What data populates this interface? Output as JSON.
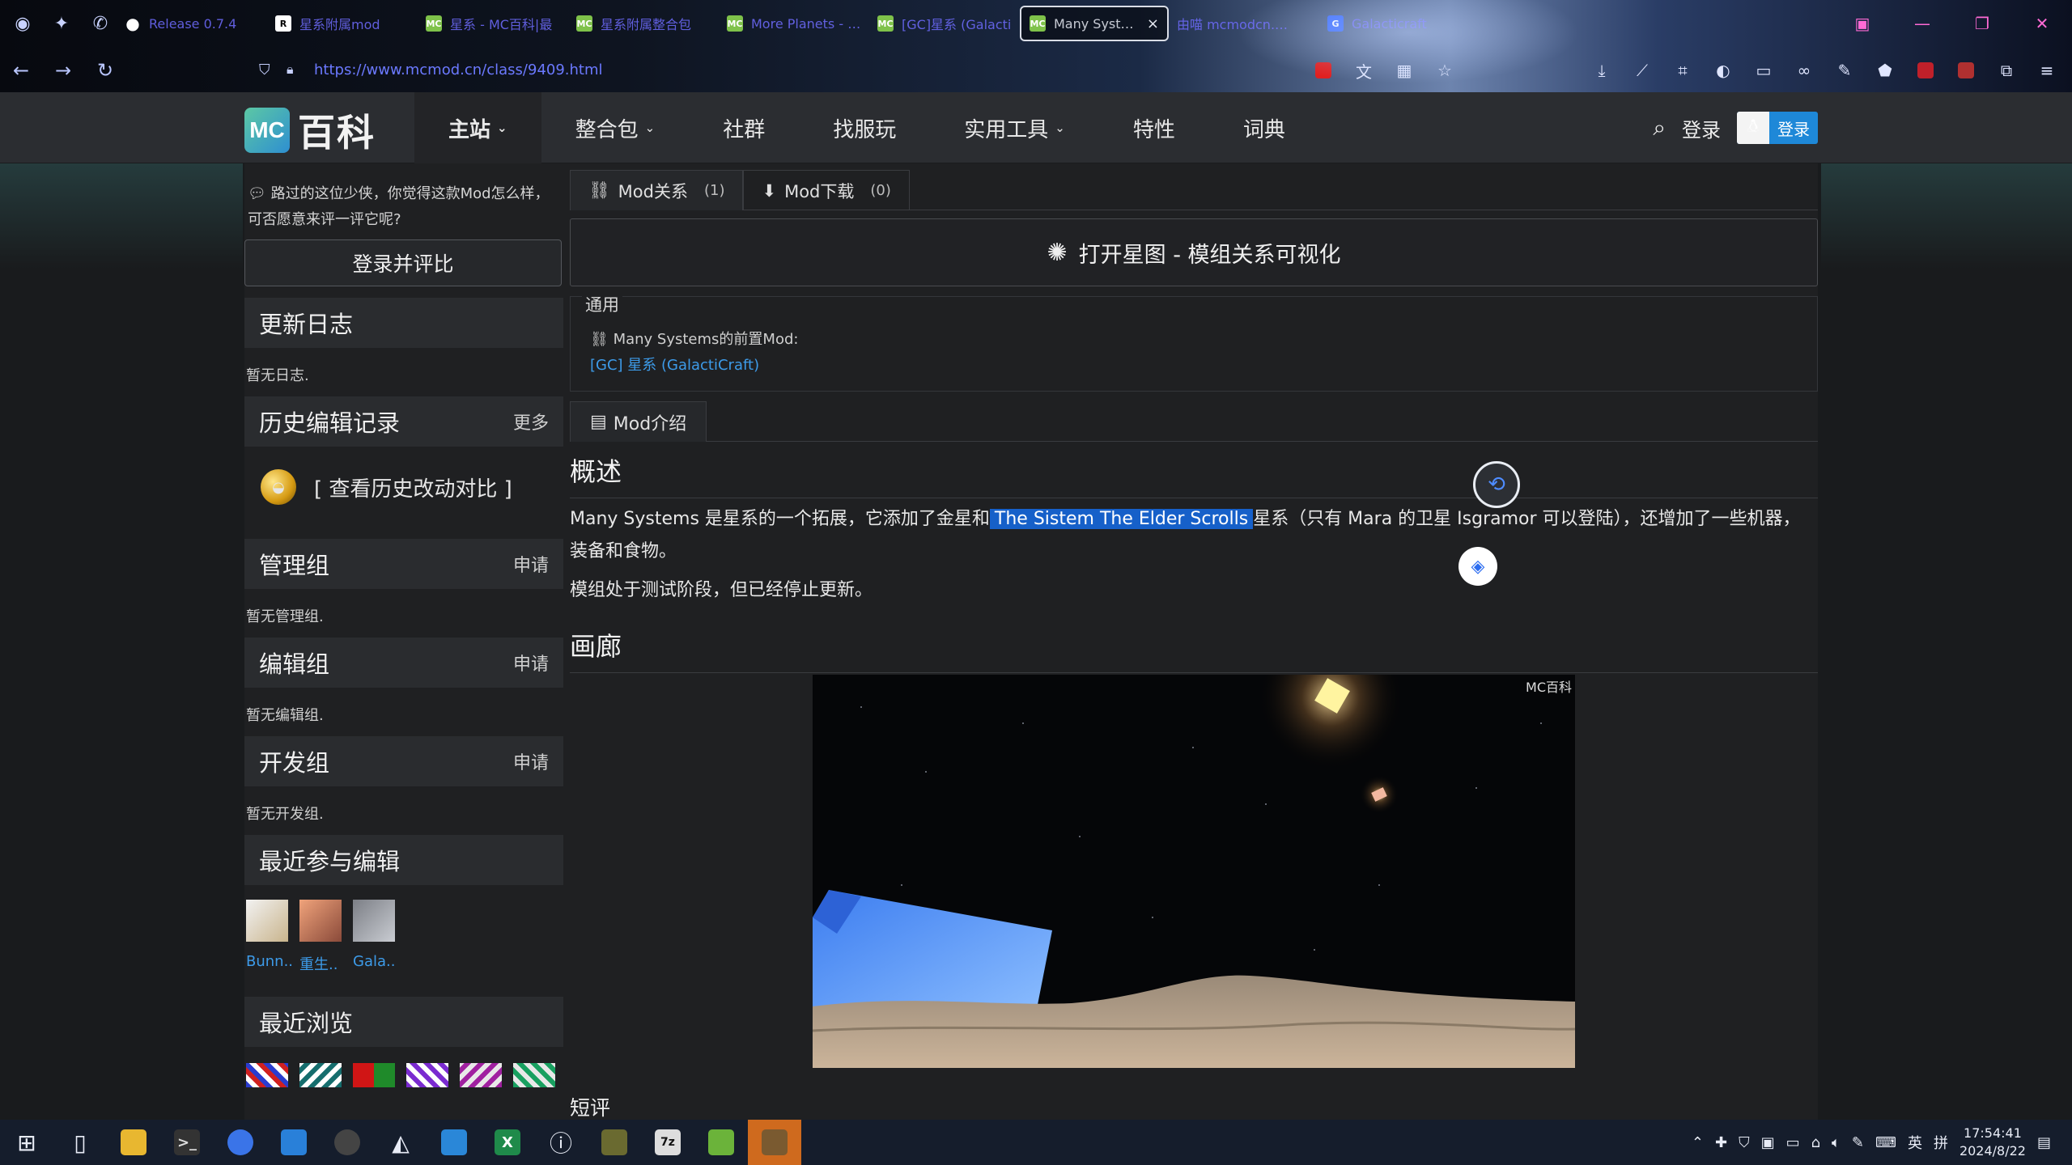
{
  "browser": {
    "tabs": [
      {
        "label": "Release 0.7.4",
        "icon": "github-icon"
      },
      {
        "label": "星系附属mod",
        "icon": "r-icon"
      },
      {
        "label": "星系 - MC百科|最",
        "icon": "mc-icon"
      },
      {
        "label": "星系附属整合包",
        "icon": "mc-icon"
      },
      {
        "label": "More Planets - Gal",
        "icon": "mc-icon"
      },
      {
        "label": "[GC]星系 (Galacti",
        "icon": "mc-icon"
      },
      {
        "label": "Many Systems -",
        "icon": "mc-icon",
        "active": true
      },
      {
        "label": "由喵 mcmodcn.com",
        "icon": "none"
      },
      {
        "label": "Galacticraft",
        "icon": "blue-icon"
      }
    ],
    "url": "https://www.mcmod.cn/class/9409.html",
    "close_tab": "×"
  },
  "site": {
    "logo_mc": "MC",
    "logo_text": "百科",
    "nav": [
      {
        "label": "主站",
        "caret": true,
        "active": true
      },
      {
        "label": "整合包",
        "caret": true
      },
      {
        "label": "社群",
        "caret": false
      },
      {
        "label": "找服玩",
        "caret": false
      },
      {
        "label": "实用工具",
        "caret": true
      },
      {
        "label": "特性",
        "caret": false
      },
      {
        "label": "词典",
        "caret": false
      }
    ],
    "login": "登录",
    "qq_login": "登录"
  },
  "sidebar": {
    "rate_note": "路过的这位少侠，你觉得这款Mod怎么样，可否愿意来评一评它呢?",
    "rate_button": "登录并评比",
    "changelog_title": "更新日志",
    "changelog_empty": "暂无日志.",
    "history_title": "历史编辑记录",
    "history_more": "更多",
    "history_compare": "[ 查看历史改动对比 ]",
    "admin_title": "管理组",
    "admin_apply": "申请",
    "admin_empty": "暂无管理组.",
    "editor_title": "编辑组",
    "editor_apply": "申请",
    "editor_empty": "暂无编辑组.",
    "dev_title": "开发组",
    "dev_apply": "申请",
    "dev_empty": "暂无开发组.",
    "recent_edit_title": "最近参与编辑",
    "recent_editors": [
      "Bunn..",
      "重生..",
      "Gala.."
    ],
    "recent_view_title": "最近浏览"
  },
  "main": {
    "subtabs": [
      {
        "label": "Mod关系",
        "count": "(1)"
      },
      {
        "label": "Mod下载",
        "count": "(0)"
      }
    ],
    "starmap": "打开星图 - 模组关系可视化",
    "rel_legend": "通用",
    "rel_line": "Many Systems的前置Mod:",
    "rel_link": "[GC] 星系 (GalactiCraft)",
    "intro_tab": "Mod介绍",
    "overview_title": "概述",
    "para1_a": "Many Systems 是星系的一个拓展，它添加了金星和",
    "para1_hl": "The Sistem The Elder Scrolls",
    "para1_b": "星系（只有 Mara 的卫星 Isgramor 可以登陆），还增加了一些机器，装备和食物。",
    "para2": "模组处于测试阶段，但已经停止更新。",
    "gallery_title": "画廊",
    "gallery_watermark": "MC百科",
    "short_review": "短评"
  },
  "taskbar": {
    "time": "17:54:41",
    "date": "2024/8/22",
    "ime": "英",
    "ime2": "拼"
  }
}
